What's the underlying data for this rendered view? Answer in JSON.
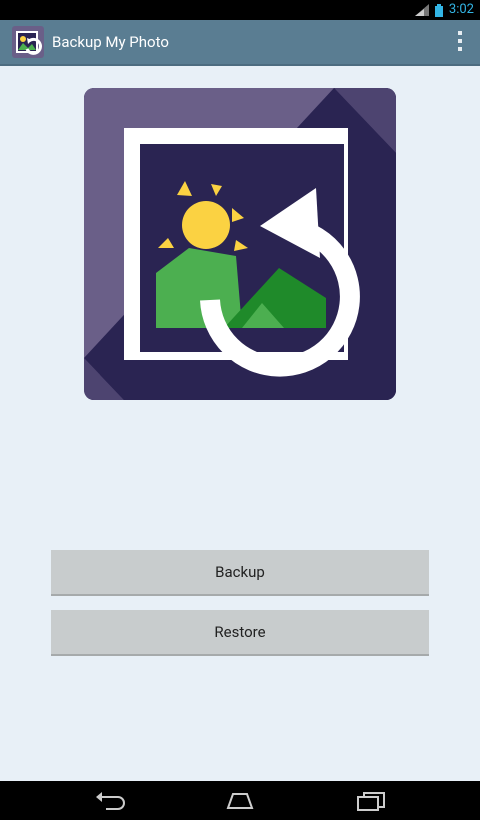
{
  "status_bar": {
    "time": "3:02"
  },
  "action_bar": {
    "title": "Backup My Photo"
  },
  "buttons": {
    "backup": "Backup",
    "restore": "Restore"
  },
  "colors": {
    "action_bar": "#5a7d92",
    "hero_tile": "#6a5f88",
    "hero_inner": "#2a2452",
    "sun": "#fbd242",
    "hill_light": "#4caf50",
    "hill_dark": "#1f8a2a",
    "button_bg": "#c8cccd"
  },
  "icons": [
    "signal-icon",
    "battery-icon",
    "app-icon",
    "overflow-menu-icon",
    "back-icon",
    "home-icon",
    "recents-icon"
  ]
}
